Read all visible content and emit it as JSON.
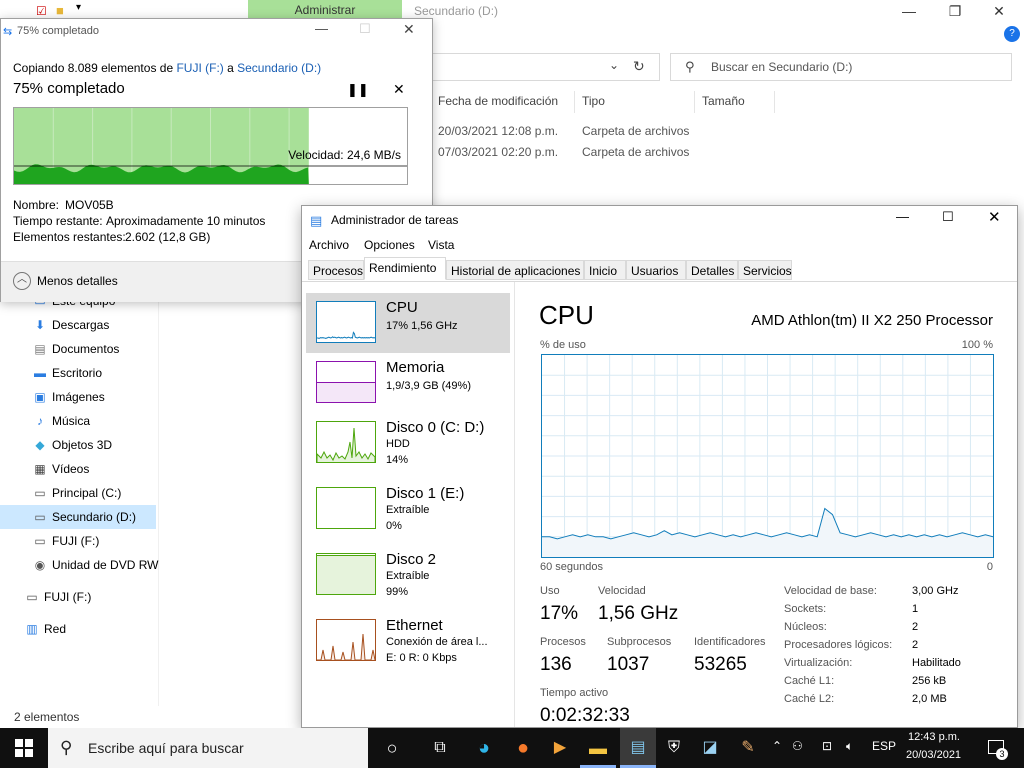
{
  "explorer": {
    "admin_tab": "Administrar",
    "title": "Secundario (D:)",
    "search_placeholder": "Buscar en Secundario (D:)",
    "columns": [
      "Fecha de modificación",
      "Tipo",
      "Tamaño"
    ],
    "rows": [
      {
        "date": "20/03/2021 12:08 p.m.",
        "type": "Carpeta de archivos"
      },
      {
        "date": "07/03/2021 02:20 p.m.",
        "type": "Carpeta de archivos"
      }
    ],
    "nav": [
      {
        "label": "Este equipo",
        "icon": "computer-icon"
      },
      {
        "label": "Descargas",
        "icon": "download-icon"
      },
      {
        "label": "Documentos",
        "icon": "document-icon"
      },
      {
        "label": "Escritorio",
        "icon": "desktop-icon"
      },
      {
        "label": "Imágenes",
        "icon": "pictures-icon"
      },
      {
        "label": "Música",
        "icon": "music-icon"
      },
      {
        "label": "Objetos 3D",
        "icon": "cube-icon"
      },
      {
        "label": "Vídeos",
        "icon": "video-icon"
      },
      {
        "label": "Principal (C:)",
        "icon": "drive-icon"
      },
      {
        "label": "Secundario (D:)",
        "icon": "drive-icon"
      },
      {
        "label": "FUJI (F:)",
        "icon": "drive-icon"
      },
      {
        "label": "Unidad de DVD RW",
        "icon": "dvd-icon"
      },
      {
        "label": "FUJI (F:)",
        "icon": "drive-icon"
      },
      {
        "label": "Red",
        "icon": "network-icon"
      }
    ],
    "status": "2 elementos"
  },
  "copy": {
    "title": "75% completado",
    "line_prefix": "Copiando 8.089 elementos de ",
    "source": "FUJI (F:)",
    "line_mid": " a ",
    "dest": "Secundario (D:)",
    "heading": "75% completado",
    "progress": 0.75,
    "speed": "Velocidad: 24,6 MB/s",
    "name_label": "Nombre:",
    "name_value": "MOV05B",
    "time_label": "Tiempo restante:",
    "time_value": "Aproximadamente 10 minutos",
    "items_label": "Elementos restantes:",
    "items_value": "2.602 (12,8 GB)",
    "less_details": "Menos detalles"
  },
  "taskmgr": {
    "title": "Administrador de tareas",
    "menu": [
      "Archivo",
      "Opciones",
      "Vista"
    ],
    "tabs": [
      "Procesos",
      "Rendimiento",
      "Historial de aplicaciones",
      "Inicio",
      "Usuarios",
      "Detalles",
      "Servicios"
    ],
    "resources": [
      {
        "name": "CPU",
        "sub1": "17% 1,56 GHz",
        "sub2": ""
      },
      {
        "name": "Memoria",
        "sub1": "1,9/3,9 GB (49%)",
        "sub2": ""
      },
      {
        "name": "Disco 0 (C: D:)",
        "sub1": "HDD",
        "sub2": "14%"
      },
      {
        "name": "Disco 1 (E:)",
        "sub1": "Extraíble",
        "sub2": "0%"
      },
      {
        "name": "Disco 2",
        "sub1": "Extraíble",
        "sub2": "99%"
      },
      {
        "name": "Ethernet",
        "sub1": "Conexión de área l...",
        "sub2": "E: 0 R: 0 Kbps"
      }
    ],
    "cpu": {
      "heading": "CPU",
      "model": "AMD Athlon(tm) II X2 250 Processor",
      "usage_label": "% de uso",
      "usage_max": "100 %",
      "time_left": "60 segundos",
      "time_right": "0",
      "usage_history": [
        10,
        10,
        9,
        10,
        11,
        10,
        11,
        10,
        10,
        9,
        10,
        11,
        12,
        11,
        10,
        11,
        13,
        11,
        12,
        11,
        10,
        11,
        12,
        11,
        10,
        11,
        10,
        11,
        12,
        11,
        10,
        11,
        12,
        11,
        10,
        11,
        10,
        24,
        21,
        12,
        11,
        10,
        11,
        12,
        11,
        10,
        11,
        10,
        11,
        10,
        11,
        10,
        11,
        10,
        11,
        12,
        11,
        10,
        11,
        10
      ]
    },
    "stats": {
      "uso_label": "Uso",
      "uso": "17%",
      "vel_label": "Velocidad",
      "vel": "1,56 GHz",
      "proc_label": "Procesos",
      "proc": "136",
      "sub_label": "Subprocesos",
      "sub": "1037",
      "ident_label": "Identificadores",
      "ident": "53265",
      "active_label": "Tiempo activo",
      "active": "0:02:32:33"
    },
    "specs": [
      {
        "k": "Velocidad de base:",
        "v": "3,00 GHz"
      },
      {
        "k": "Sockets:",
        "v": "1"
      },
      {
        "k": "Núcleos:",
        "v": "2"
      },
      {
        "k": "Procesadores lógicos:",
        "v": "2"
      },
      {
        "k": "Virtualización:",
        "v": "Habilitado"
      },
      {
        "k": "Caché L1:",
        "v": "256 kB"
      },
      {
        "k": "Caché L2:",
        "v": "2,0 MB"
      }
    ]
  },
  "taskbar": {
    "search_placeholder": "Escribe aquí para buscar",
    "lang": "ESP",
    "time": "12:43 p.m.",
    "date": "20/03/2021",
    "notifications": "3"
  }
}
